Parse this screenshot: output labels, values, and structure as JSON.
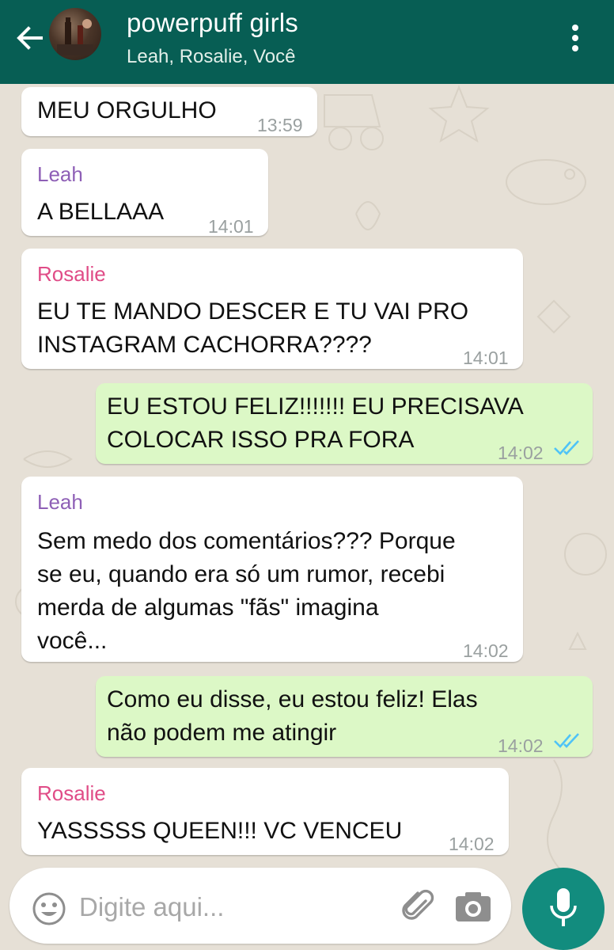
{
  "header": {
    "title": "powerpuff girls",
    "subtitle": "Leah, Rosalie, Você",
    "back_icon": "arrow-left-icon",
    "menu_icon": "more-vert-icon"
  },
  "colors": {
    "header": "#075e54",
    "incoming_bubble": "#ffffff",
    "outgoing_bubble": "#dcf8c6",
    "leah": "#8e5fb6",
    "rosalie": "#e04c87",
    "read_ticks": "#4fc3f7",
    "mic_button": "#128c7e"
  },
  "messages": [
    {
      "direction": "in",
      "sender": "",
      "lines": [
        "MEU ORGULHO"
      ],
      "time": "13:59"
    },
    {
      "direction": "in",
      "sender": "Leah",
      "lines": [
        "A BELLAAA"
      ],
      "time": "14:01"
    },
    {
      "direction": "in",
      "sender": "Rosalie",
      "lines": [
        "EU TE MANDO DESCER E TU VAI PRO",
        "INSTAGRAM CACHORRA????"
      ],
      "time": "14:01"
    },
    {
      "direction": "out",
      "sender": "",
      "lines": [
        "EU ESTOU FELIZ!!!!!!! EU PRECISAVA",
        "COLOCAR ISSO PRA FORA"
      ],
      "time": "14:02",
      "status": "read"
    },
    {
      "direction": "in",
      "sender": "Leah",
      "lines": [
        "Sem medo dos comentários??? Porque",
        "se eu, quando era só um rumor, recebi",
        "merda de algumas \"fãs\" imagina",
        "você..."
      ],
      "time": "14:02"
    },
    {
      "direction": "out",
      "sender": "",
      "lines": [
        "Como eu disse, eu estou feliz! Elas",
        "não podem me atingir"
      ],
      "time": "14:02",
      "status": "read"
    },
    {
      "direction": "in",
      "sender": "Rosalie",
      "lines": [
        "YASSSSS QUEEN!!! VC VENCEU"
      ],
      "time": "14:02"
    }
  ],
  "input": {
    "placeholder": "Digite aqui...",
    "emoji_icon": "emoji-icon",
    "attach_icon": "paperclip-icon",
    "camera_icon": "camera-icon",
    "mic_icon": "microphone-icon"
  }
}
